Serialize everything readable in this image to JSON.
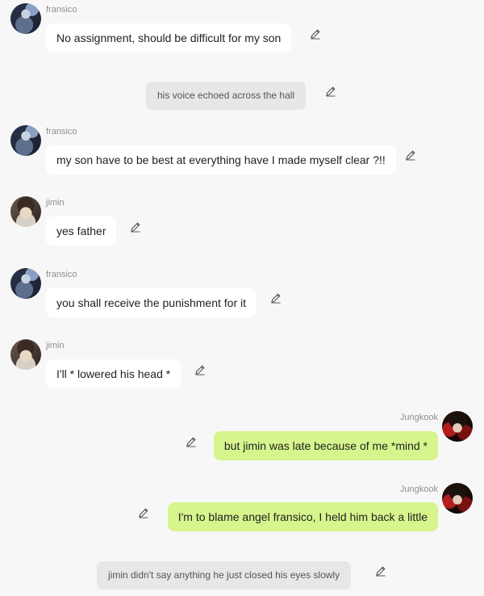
{
  "messages": [
    {
      "type": "left",
      "speaker": "fransico",
      "text": "No assignment,  should be difficult for my son"
    },
    {
      "type": "narration",
      "text": "his voice echoed across the hall"
    },
    {
      "type": "left",
      "speaker": "fransico",
      "text": "my son have to be best at everything have I made myself clear ?!!"
    },
    {
      "type": "left",
      "speaker": "jimin",
      "text": "yes father"
    },
    {
      "type": "left",
      "speaker": "fransico",
      "text": "you shall receive the punishment for it"
    },
    {
      "type": "left",
      "speaker": "jimin",
      "text": "I'll * lowered his head *"
    },
    {
      "type": "right",
      "speaker": "Jungkook",
      "text": "but jimin was late because of me *mind *"
    },
    {
      "type": "right",
      "speaker": "Jungkook",
      "text": "I'm to blame angel fransico,  I held him back a little"
    },
    {
      "type": "narration",
      "text": "jimin didn't say anything he just closed his eyes slowly"
    }
  ],
  "icons": {
    "avatar": "avatar",
    "edit": "pencil-edit-icon"
  },
  "colors": {
    "background": "#f7f7f7",
    "left_bubble": "#ffffff",
    "right_bubble": "#d6f58c",
    "narration_bubble": "#e7e7e7",
    "name_text": "#8f8f8f"
  }
}
